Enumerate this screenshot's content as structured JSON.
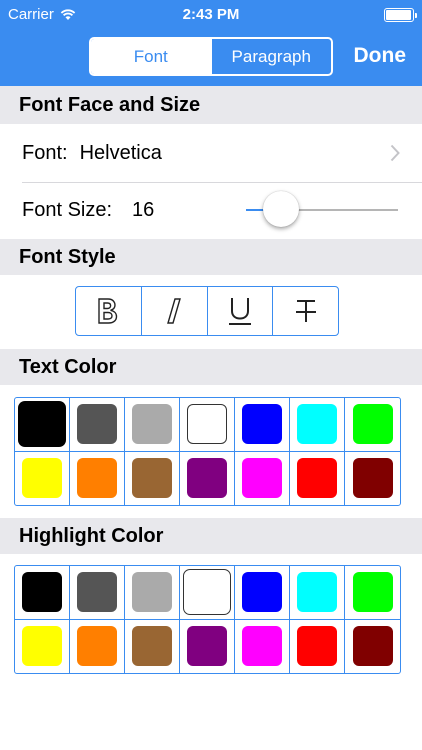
{
  "status_bar": {
    "carrier": "Carrier",
    "time": "2:43 PM"
  },
  "header": {
    "tabs": [
      {
        "label": "Font",
        "active": true
      },
      {
        "label": "Paragraph",
        "active": false
      }
    ],
    "done_label": "Done"
  },
  "font_face_section": {
    "title": "Font Face and Size",
    "font_label": "Font:",
    "font_value": "Helvetica",
    "size_label": "Font Size:",
    "size_value": "16",
    "size_slider_fraction": 0.23
  },
  "font_style_section": {
    "title": "Font Style",
    "buttons": [
      {
        "name": "bold",
        "icon": "bold-icon"
      },
      {
        "name": "italic",
        "icon": "italic-icon"
      },
      {
        "name": "underline",
        "icon": "underline-icon"
      },
      {
        "name": "strikethrough",
        "icon": "strikethrough-icon"
      }
    ]
  },
  "text_color_section": {
    "title": "Text Color",
    "colors": [
      "#000000",
      "#555555",
      "#aaaaaa",
      "#ffffff",
      "#0000ff",
      "#00ffff",
      "#00ff00",
      "#ffff00",
      "#ff7f00",
      "#996633",
      "#800080",
      "#ff00ff",
      "#ff0000",
      "#800000"
    ],
    "selected_index": 0
  },
  "highlight_color_section": {
    "title": "Highlight Color",
    "colors": [
      "#000000",
      "#555555",
      "#aaaaaa",
      "#ffffff",
      "#0000ff",
      "#00ffff",
      "#00ff00",
      "#ffff00",
      "#ff7f00",
      "#996633",
      "#800080",
      "#ff00ff",
      "#ff0000",
      "#800000"
    ],
    "selected_index": 3
  },
  "accent_color": "#3a8cf0"
}
